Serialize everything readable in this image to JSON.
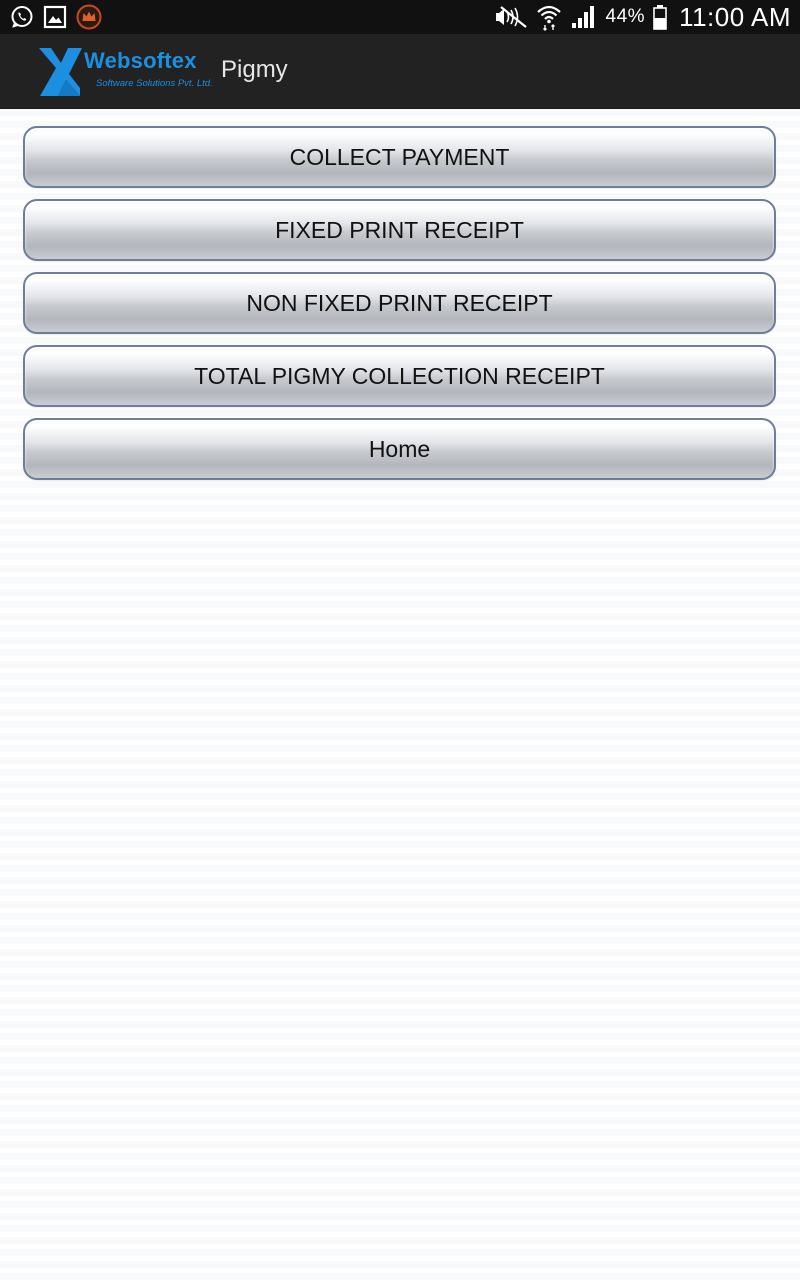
{
  "status_bar": {
    "icons_left": [
      "whatsapp-icon",
      "gallery-icon",
      "crown-app-icon"
    ],
    "icons_right": [
      "mute-icon",
      "wifi-icon",
      "signal-icon",
      "battery-icon"
    ],
    "battery": "44%",
    "time": "11:00 AM"
  },
  "action_bar": {
    "logo_name": "Websoftex",
    "logo_tagline": "Software Solutions Pvt. Ltd.",
    "title": "Pigmy",
    "logo_color": "#1d8fe0"
  },
  "menu": {
    "buttons": [
      {
        "label": "COLLECT PAYMENT"
      },
      {
        "label": "FIXED PRINT RECEIPT"
      },
      {
        "label": "NON FIXED PRINT RECEIPT"
      },
      {
        "label": "TOTAL PIGMY COLLECTION RECEIPT"
      },
      {
        "label": "Home"
      }
    ]
  }
}
